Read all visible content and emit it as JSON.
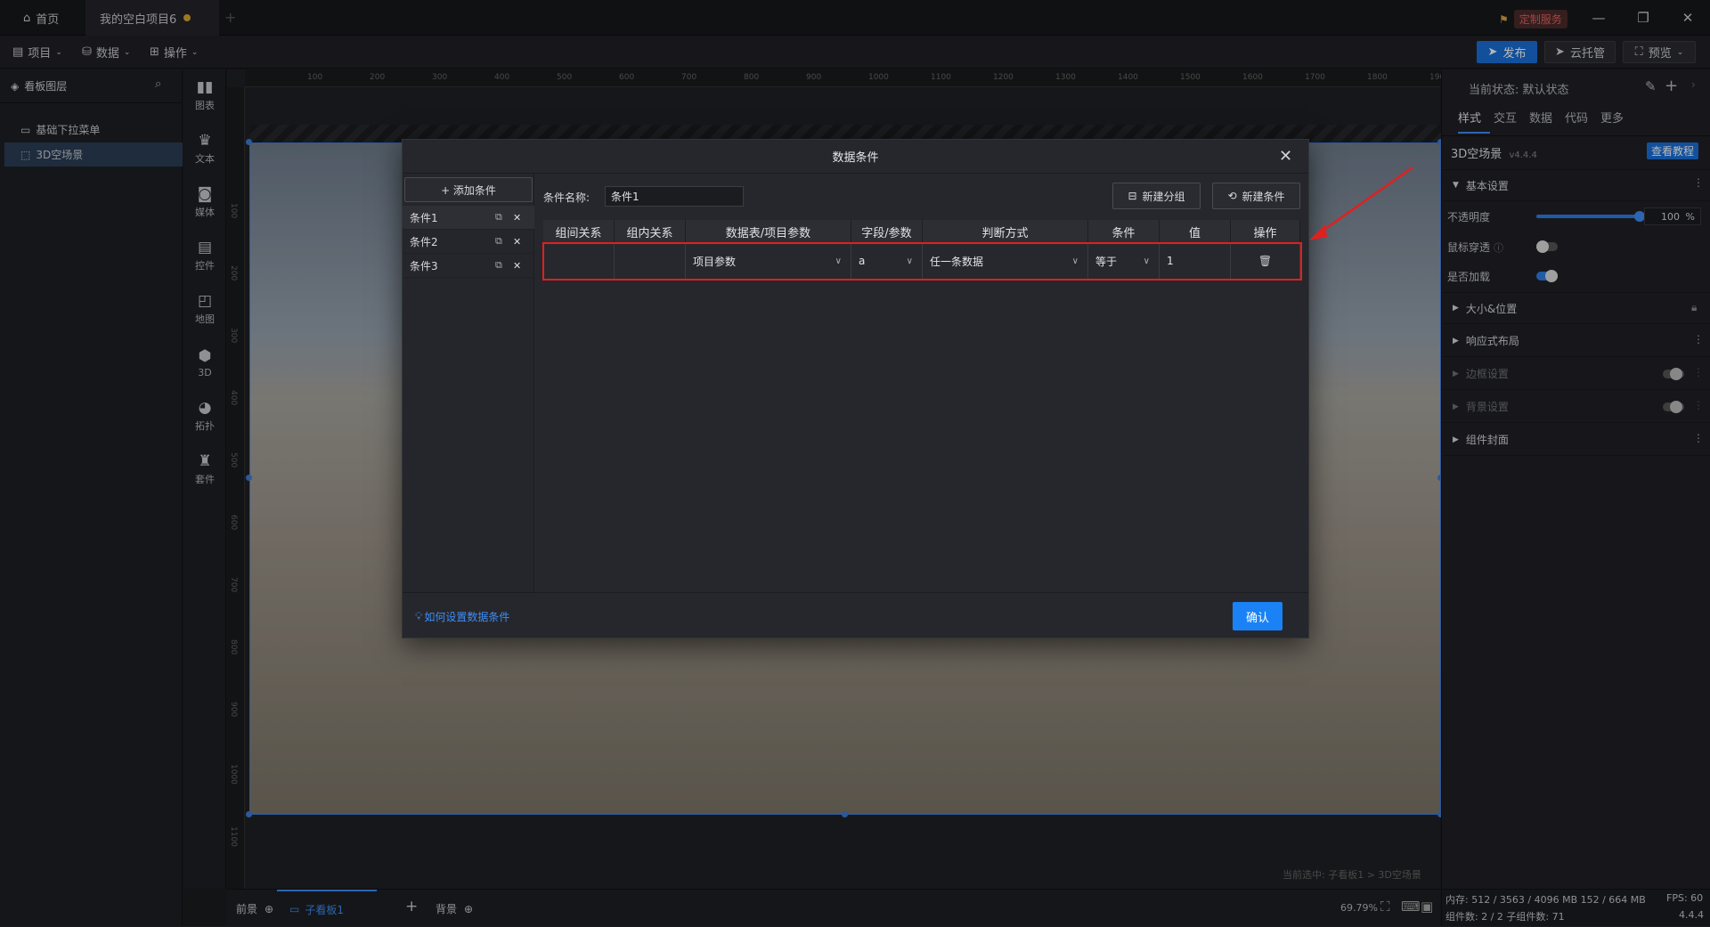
{
  "titlebar": {
    "home_tab": "首页",
    "project_tab": "我的空白项目6",
    "service": "定制服务"
  },
  "toolbar": {
    "menu_project": "项目",
    "menu_data": "数据",
    "menu_ops": "操作",
    "publish": "发布",
    "cloud": "云托管",
    "preview": "预览"
  },
  "layers": {
    "title": "看板图层",
    "items": [
      "基础下拉菜单",
      "3D空场景"
    ]
  },
  "tools": [
    {
      "label": "图表",
      "icon": "chart-icon"
    },
    {
      "label": "文本",
      "icon": "text-icon"
    },
    {
      "label": "媒体",
      "icon": "media-icon"
    },
    {
      "label": "控件",
      "icon": "control-icon"
    },
    {
      "label": "地图",
      "icon": "map-icon"
    },
    {
      "label": "3D",
      "icon": "cube-icon"
    },
    {
      "label": "拓扑",
      "icon": "topology-icon"
    },
    {
      "label": "套件",
      "icon": "kit-icon"
    }
  ],
  "ruler": {
    "h": [
      "100",
      "200",
      "300",
      "400",
      "500",
      "600",
      "700",
      "800",
      "900",
      "1000",
      "1100",
      "1200",
      "1300",
      "1400",
      "1500",
      "1600",
      "1700",
      "1800",
      "1900"
    ],
    "v": [
      "100",
      "200",
      "300",
      "400",
      "500",
      "600",
      "700",
      "800",
      "900",
      "1000",
      "1100"
    ]
  },
  "bottom": {
    "front": "前景",
    "sub": "子看板1",
    "back": "背景",
    "zoom": "69.79%",
    "selected": "当前选中: 子看板1 > 3D空场景"
  },
  "right": {
    "state": "当前状态: 默认状态",
    "tabs": [
      "样式",
      "交互",
      "数据",
      "代码",
      "更多"
    ],
    "comp_name": "3D空场景",
    "version": "v4.4.4",
    "tutorial": "查看教程",
    "basic": "基本设置",
    "opacity_label": "不透明度",
    "opacity_value": "100",
    "opacity_unit": "%",
    "opacity_level": 100,
    "mouse_label": "鼠标穿透",
    "load_label": "是否加载",
    "sections": [
      "大小&位置",
      "响应式布局",
      "边框设置",
      "背景设置",
      "组件封面"
    ],
    "stats1": "内存: 512 / 3563 / 4096 MB  152 / 664 MB",
    "fps": "FPS: 60",
    "stats2": "组件数: 2 / 2  子组件数: 71",
    "ver": "4.4.4"
  },
  "modal": {
    "title": "数据条件",
    "add": "+ 添加条件",
    "conditions": [
      "条件1",
      "条件2",
      "条件3"
    ],
    "name_label": "条件名称:",
    "name_value": "条件1",
    "new_group": "新建分组",
    "new_cond": "新建条件",
    "headers": [
      "组间关系",
      "组内关系",
      "数据表/项目参数",
      "字段/参数",
      "判断方式",
      "条件",
      "值",
      "操作"
    ],
    "row": {
      "source": "项目参数",
      "field": "a",
      "judge": "任一条数据",
      "cond": "等于",
      "value": "1"
    },
    "help": "如何设置数据条件",
    "confirm": "确认"
  },
  "colors": {
    "accent": "#1a82f5",
    "highlight": "#e02020"
  }
}
